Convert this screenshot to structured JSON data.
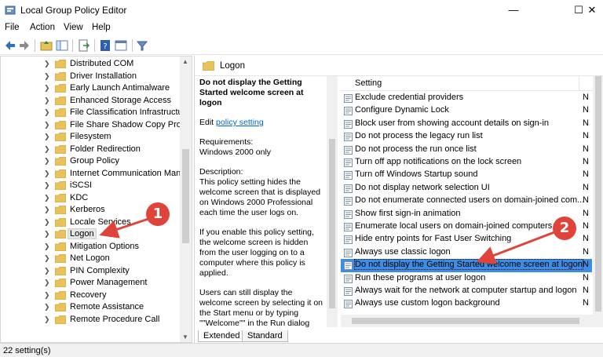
{
  "window": {
    "title": "Local Group Policy Editor",
    "minimize": "—",
    "maximize": "☐",
    "close": "✕"
  },
  "menu": [
    "File",
    "Action",
    "View",
    "Help"
  ],
  "tree": {
    "items": [
      {
        "label": "Distributed COM"
      },
      {
        "label": "Driver Installation"
      },
      {
        "label": "Early Launch Antimalware"
      },
      {
        "label": "Enhanced Storage Access"
      },
      {
        "label": "File Classification Infrastructure"
      },
      {
        "label": "File Share Shadow Copy Provider"
      },
      {
        "label": "Filesystem"
      },
      {
        "label": "Folder Redirection"
      },
      {
        "label": "Group Policy"
      },
      {
        "label": "Internet Communication Management"
      },
      {
        "label": "iSCSI"
      },
      {
        "label": "KDC"
      },
      {
        "label": "Kerberos"
      },
      {
        "label": "Locale Services"
      },
      {
        "label": "Logon"
      },
      {
        "label": "Mitigation Options"
      },
      {
        "label": "Net Logon"
      },
      {
        "label": "PIN Complexity"
      },
      {
        "label": "Power Management"
      },
      {
        "label": "Recovery"
      },
      {
        "label": "Remote Assistance"
      },
      {
        "label": "Remote Procedure Call"
      }
    ]
  },
  "pane": {
    "header": "Logon",
    "description": {
      "title": "Do not display the Getting Started welcome screen at logon",
      "edit_prefix": "Edit ",
      "edit_link": "policy setting",
      "requirements": "Requirements:\nWindows 2000 only",
      "description_label": "Description:",
      "description_text": "This policy setting hides the welcome screen that is displayed on Windows 2000 Professional each time the user logs on.",
      "para2": "If you enable this policy setting, the welcome screen is hidden from the user logging on to a computer where this policy is applied.",
      "para3": "Users can still display the welcome screen by selecting it on the Start menu or by typing \"\"Welcome\"\" in the Run dialog box."
    },
    "column_header": "Setting",
    "settings": [
      {
        "name": "Exclude credential providers",
        "state": "N"
      },
      {
        "name": "Configure Dynamic Lock",
        "state": "N"
      },
      {
        "name": "Block user from showing account details on sign-in",
        "state": "N"
      },
      {
        "name": "Do not process the legacy run list",
        "state": "N"
      },
      {
        "name": "Do not process the run once list",
        "state": "N"
      },
      {
        "name": "Turn off app notifications on the lock screen",
        "state": "N"
      },
      {
        "name": "Turn off Windows Startup sound",
        "state": "N"
      },
      {
        "name": "Do not display network selection UI",
        "state": "N"
      },
      {
        "name": "Do not enumerate connected users on domain-joined com...",
        "state": "N"
      },
      {
        "name": "Show first sign-in animation",
        "state": "N"
      },
      {
        "name": "Enumerate local users on domain-joined computers",
        "state": "N"
      },
      {
        "name": "Hide entry points for Fast User Switching",
        "state": "N"
      },
      {
        "name": "Always use classic logon",
        "state": "N"
      },
      {
        "name": "Do not display the Getting Started welcome screen at logon",
        "state": "N"
      },
      {
        "name": "Run these programs at user logon",
        "state": "N"
      },
      {
        "name": "Always wait for the network at computer startup and logon",
        "state": "N"
      },
      {
        "name": "Always use custom logon background",
        "state": "N"
      }
    ],
    "tabs": [
      "Extended",
      "Standard"
    ]
  },
  "status": "22 setting(s)",
  "annotations": {
    "badge1": "1",
    "badge2": "2",
    "color": "#e0433a"
  }
}
